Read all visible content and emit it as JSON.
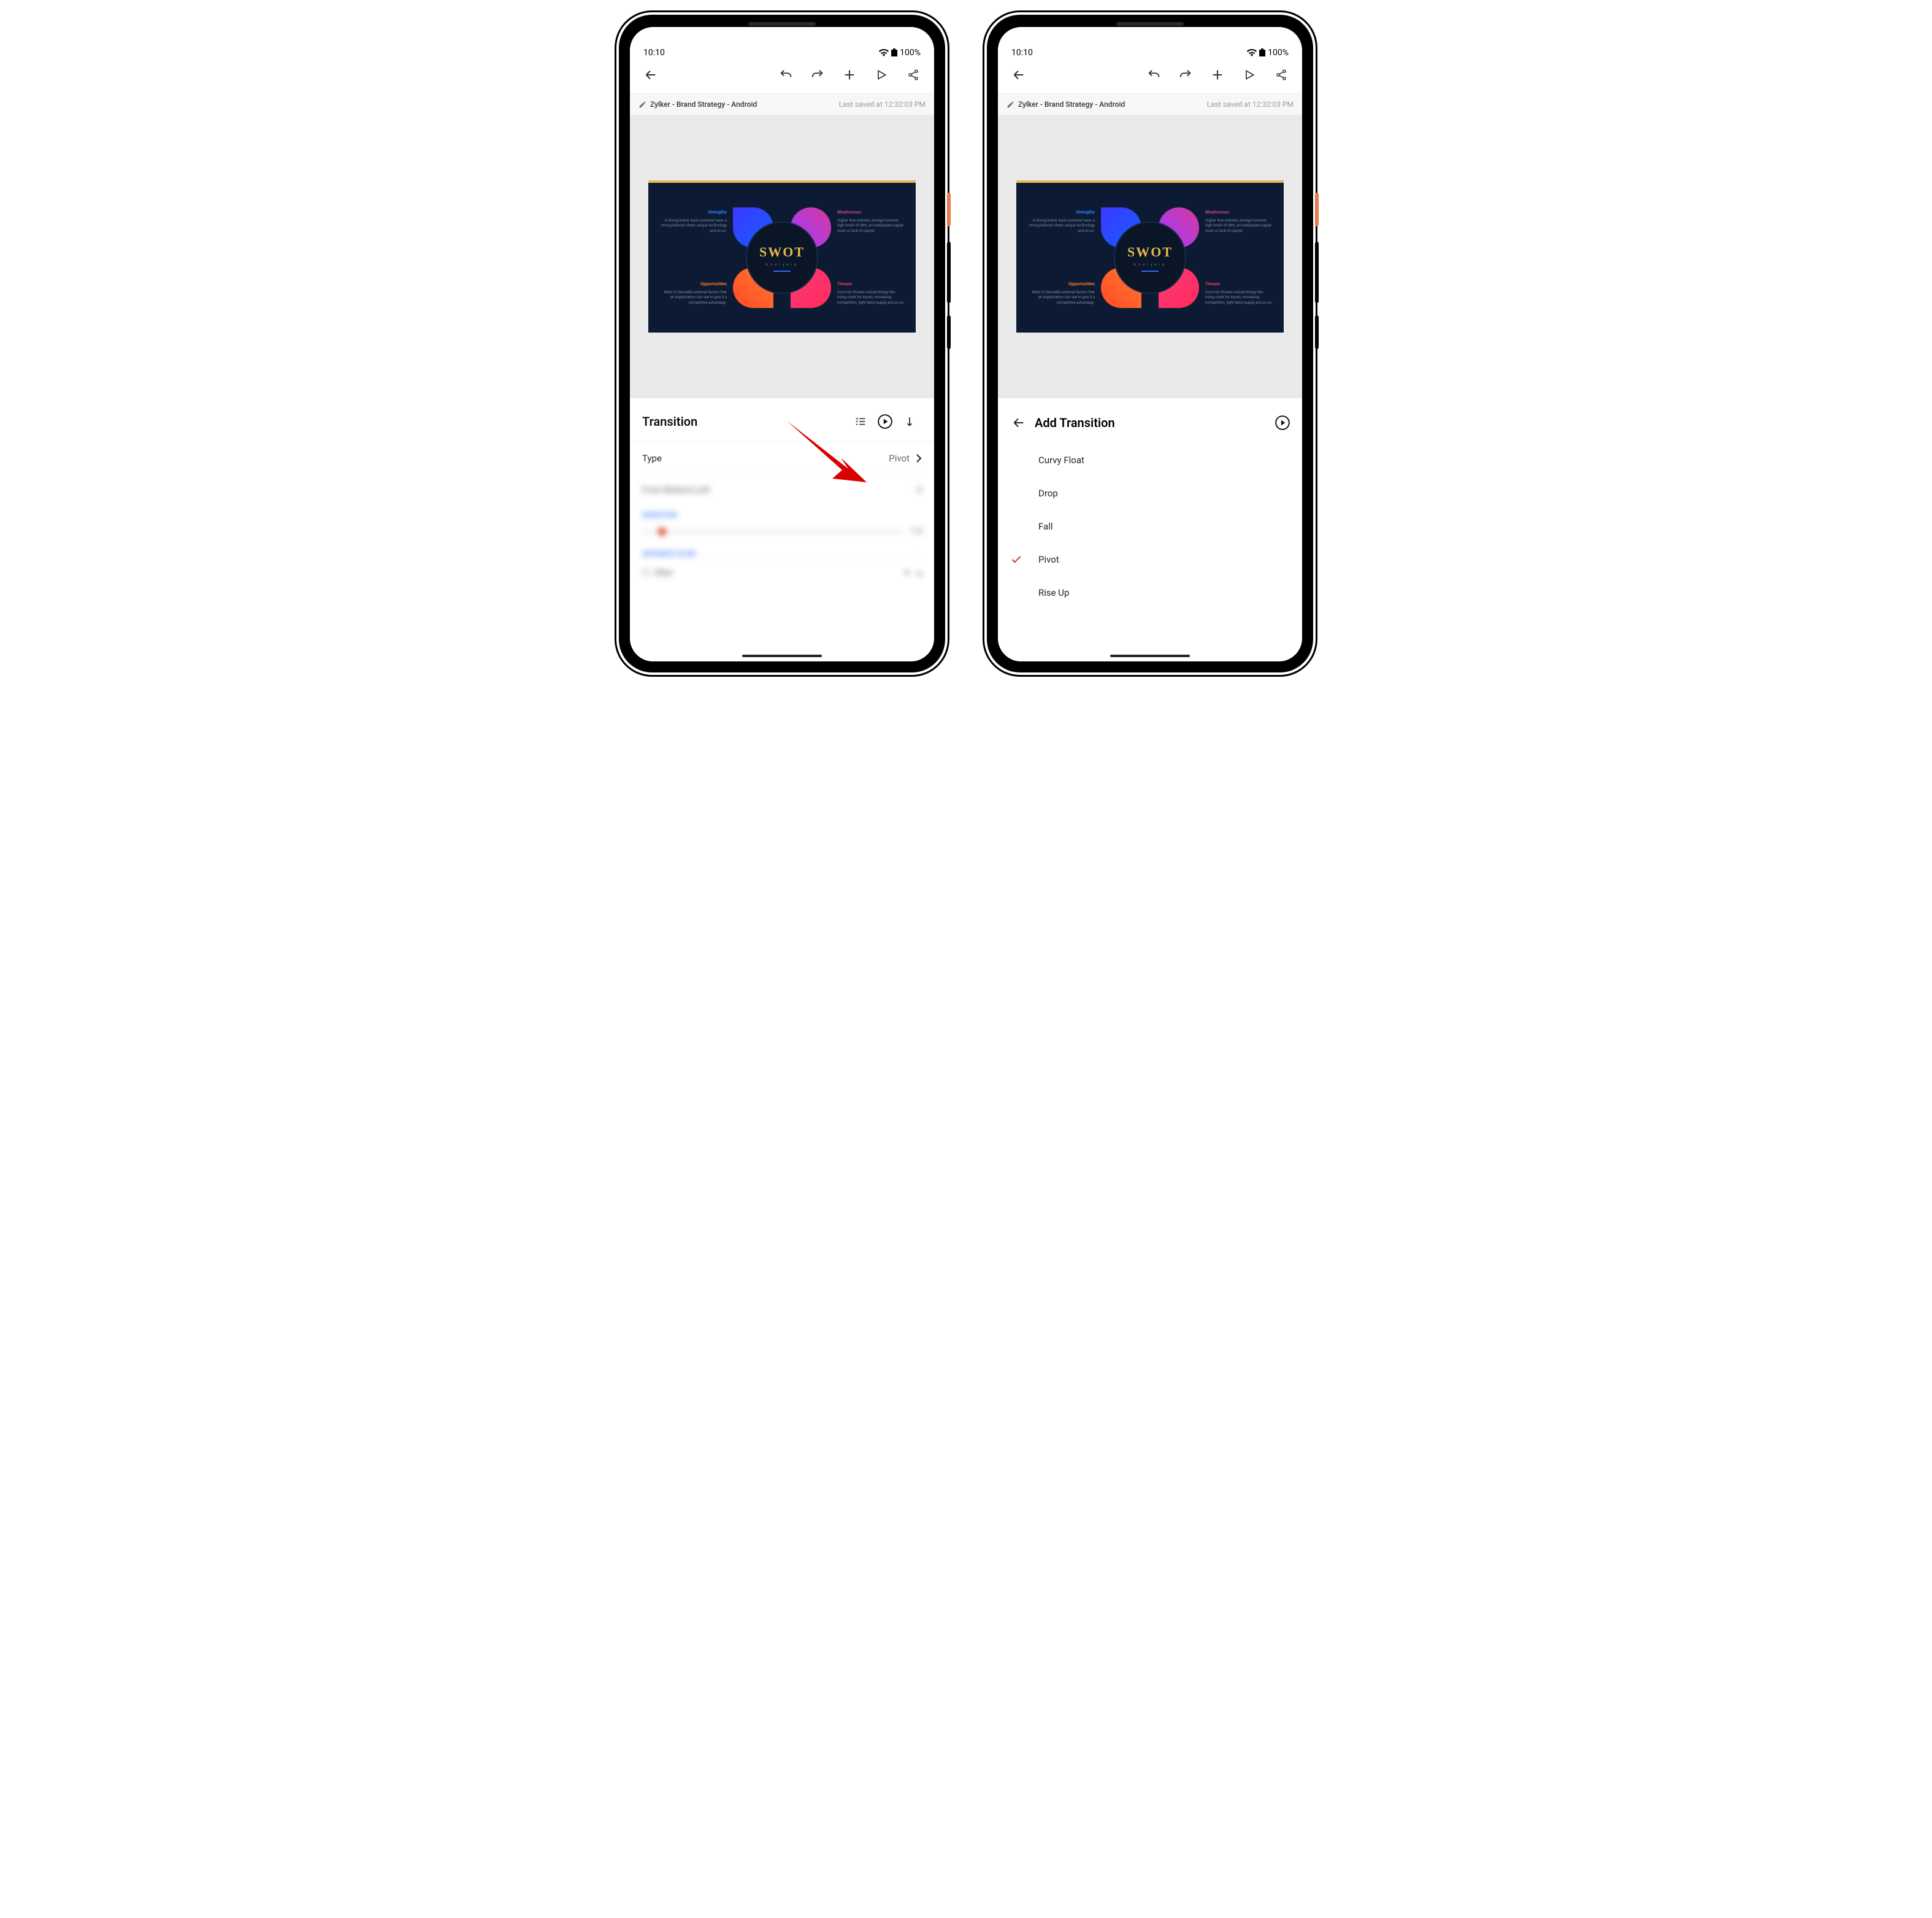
{
  "status": {
    "time": "10:10",
    "battery": "100%"
  },
  "doc": {
    "title": "Zylker - Brand Strategy - Android",
    "saved": "Last saved at 12:32:03 PM"
  },
  "slide": {
    "title": "SWOT",
    "subtitle": "Analysis",
    "q": {
      "tl": {
        "h": "Strengths",
        "b": "A strong brand, loyal customer base, a strong balance sheet, unique technology and so on."
      },
      "tr": {
        "h": "Weaknesses",
        "b": "Higher than industry average turnover, high levels of debt, an inadequate supply chain or lack of capital."
      },
      "bl": {
        "h": "Opportunities",
        "b": "Refer to favorable external factors that an organization can use to give it a competitive advantage."
      },
      "br": {
        "h": "Threats",
        "b": "Common threats include things like rising costs for inputs, increasing competition, tight labor supply and so on."
      }
    }
  },
  "panel": {
    "title": "Transition",
    "type_label": "Type",
    "type_value": "Pivot",
    "direction_value": "From Bottom-Left",
    "duration_label": "DURATION",
    "duration_value": "1.5",
    "advance_label": "ADVANCE SLIDE",
    "after_label": "After"
  },
  "list": {
    "title": "Add Transition",
    "items": [
      "Curvy Float",
      "Drop",
      "Fall",
      "Pivot",
      "Rise Up"
    ],
    "selected": "Pivot"
  }
}
